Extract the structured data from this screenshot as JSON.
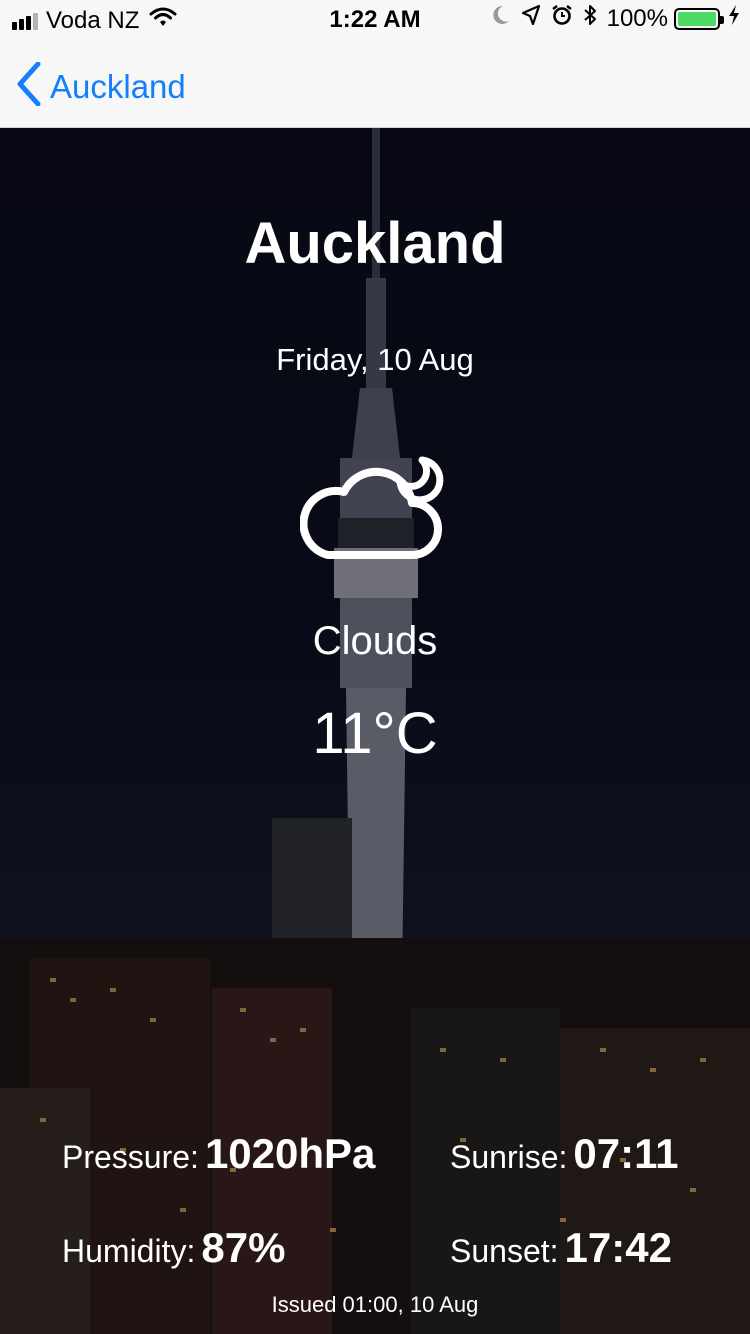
{
  "status_bar": {
    "carrier": "Voda NZ",
    "time": "1:22 AM",
    "battery_percent": "100%",
    "battery_level": 1.0,
    "signal_bars": 3,
    "signal_bars_total": 4,
    "icons": [
      "wifi-icon",
      "moon-icon",
      "location-arrow-icon",
      "alarm-icon",
      "bluetooth-icon",
      "battery-icon",
      "charging-bolt-icon"
    ]
  },
  "nav": {
    "back_label": "Auckland",
    "back_icon": "chevron-left-icon"
  },
  "weather": {
    "city": "Auckland",
    "date": "Friday, 10 Aug",
    "icon": "cloud-moon-icon",
    "condition": "Clouds",
    "temperature": "11°C",
    "pressure_label": "Pressure:",
    "pressure_value": "1020hPa",
    "sunrise_label": "Sunrise:",
    "sunrise_value": "07:11",
    "humidity_label": "Humidity:",
    "humidity_value": "87%",
    "sunset_label": "Sunset:",
    "sunset_value": "17:42",
    "issued": "Issued 01:00, 10 Aug"
  },
  "colors": {
    "accent": "#147efb",
    "battery": "#4cd964",
    "nav_background": "#f7f7f7",
    "text_on_photo": "#ffffff"
  }
}
